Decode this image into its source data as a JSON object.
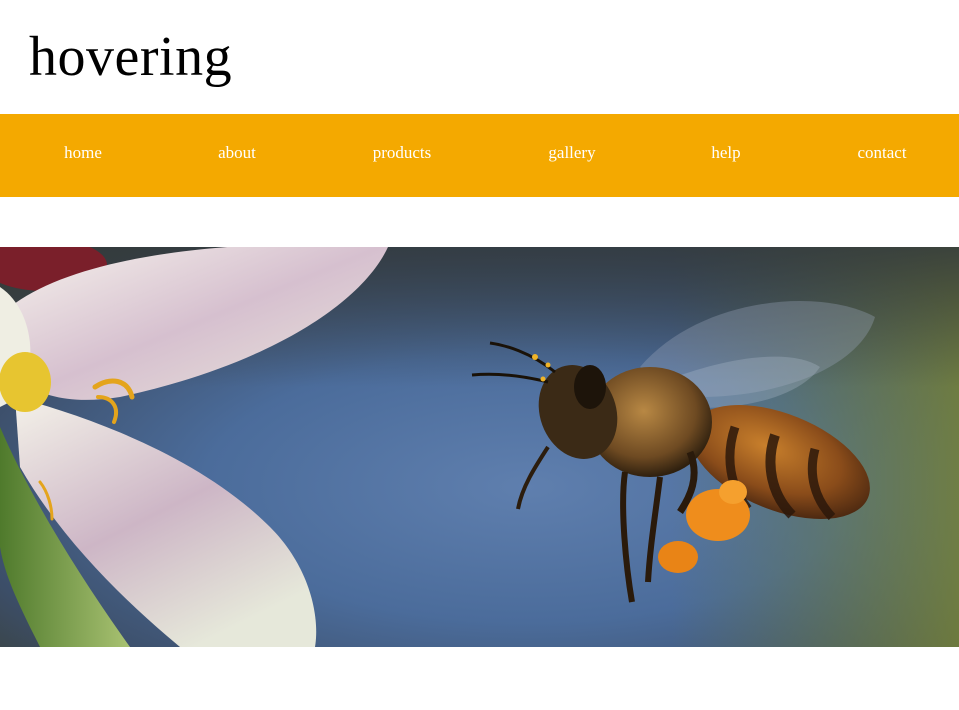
{
  "header": {
    "site_title": "hovering"
  },
  "nav": {
    "items": [
      {
        "label": "home"
      },
      {
        "label": "about"
      },
      {
        "label": "products"
      },
      {
        "label": "gallery"
      },
      {
        "label": "help"
      },
      {
        "label": "contact"
      }
    ],
    "background_color": "#f4a900",
    "text_color": "#ffffff"
  },
  "hero": {
    "image_subject": "honeybee-flying-near-white-flower"
  }
}
